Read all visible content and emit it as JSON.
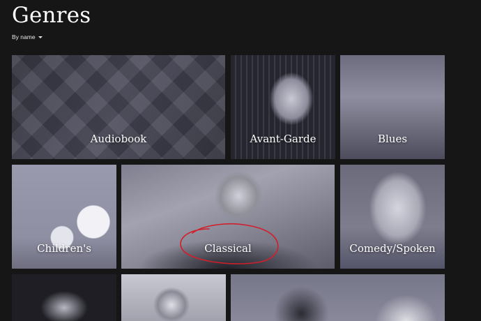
{
  "header": {
    "title": "Genres",
    "sort_label": "By name"
  },
  "genres": [
    {
      "label": "Audiobook"
    },
    {
      "label": "Avant-Garde"
    },
    {
      "label": "Blues"
    },
    {
      "label": "Children's"
    },
    {
      "label": "Classical"
    },
    {
      "label": "Comedy/Spoken"
    }
  ],
  "colors": {
    "background": "#161616",
    "tile_tint": "#5e5e70",
    "annotation": "#d21e2a"
  },
  "icons": {
    "sort_caret": "caret-down-icon"
  }
}
